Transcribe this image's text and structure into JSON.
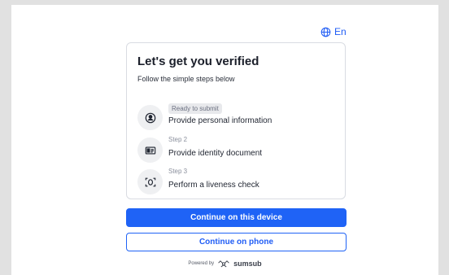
{
  "lang": {
    "label": "En",
    "icon": "globe-icon"
  },
  "card": {
    "title": "Let's get you verified",
    "subtitle": "Follow the simple steps below",
    "steps": [
      {
        "badge": "Ready to submit",
        "text": "Provide personal information",
        "icon": "user-icon"
      },
      {
        "tag": "Step 2",
        "text": "Provide identity document",
        "icon": "id-card-icon"
      },
      {
        "tag": "Step 3",
        "text": "Perform a liveness check",
        "icon": "face-scan-icon"
      }
    ]
  },
  "buttons": {
    "primary": "Continue on this device",
    "secondary": "Continue on phone"
  },
  "footer": {
    "powered_by": "Powered by",
    "brand": "sumsub"
  },
  "colors": {
    "accent": "#1f63f6",
    "background": "#e1e1e1",
    "badge_bg": "#e8e9ec"
  }
}
